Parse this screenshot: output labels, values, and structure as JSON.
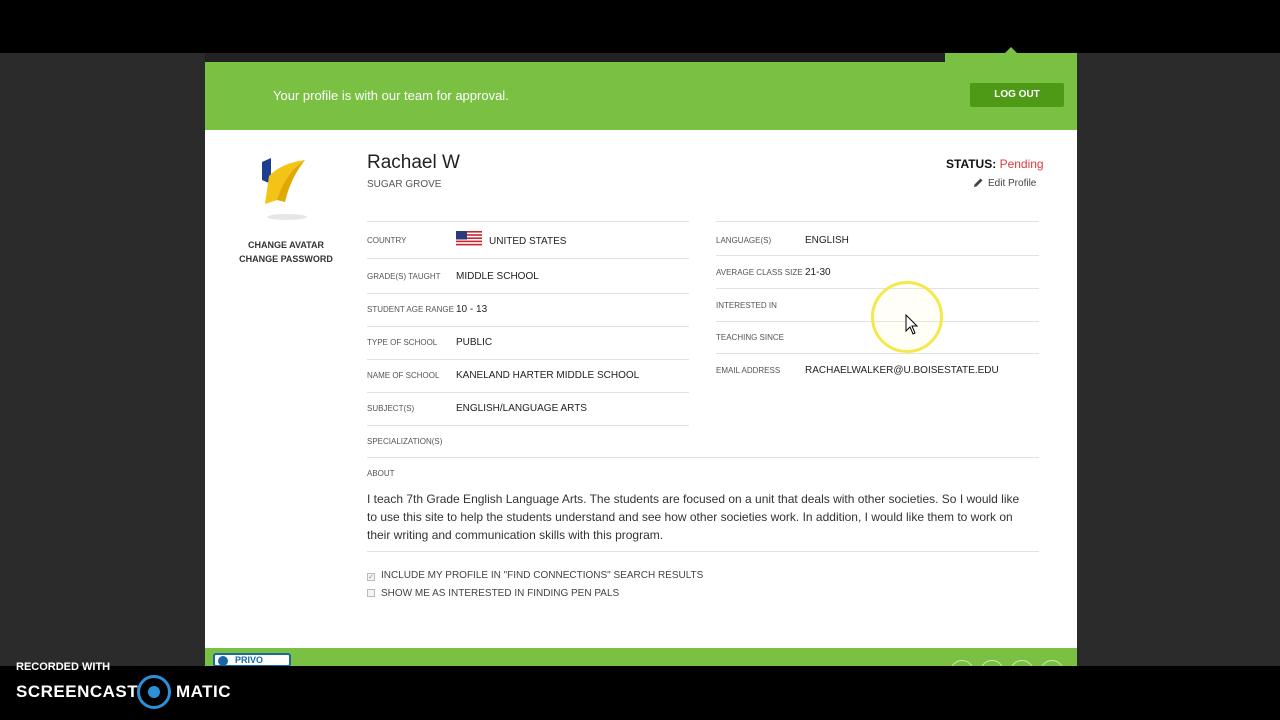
{
  "banner": {
    "message": "Your profile is with our team for approval.",
    "logout_label": "LOG OUT"
  },
  "avatar_links": {
    "change_avatar": "CHANGE AVATAR",
    "change_password": "CHANGE PASSWORD"
  },
  "profile": {
    "name": "Rachael W",
    "city": "SUGAR GROVE",
    "status_label": "STATUS:",
    "status_value": "Pending",
    "edit_label": "Edit Profile"
  },
  "left_fields": [
    {
      "label": "COUNTRY",
      "value": "UNITED STATES"
    },
    {
      "label": "GRADE(S) TAUGHT",
      "value": "MIDDLE SCHOOL"
    },
    {
      "label": "STUDENT AGE RANGE",
      "value": "10 - 13"
    },
    {
      "label": "TYPE OF SCHOOL",
      "value": "PUBLIC"
    },
    {
      "label": "NAME OF SCHOOL",
      "value": "KANELAND HARTER MIDDLE SCHOOL"
    },
    {
      "label": "SUBJECT(S)",
      "value": "ENGLISH/LANGUAGE ARTS"
    },
    {
      "label": "SPECIALIZATION(S)",
      "value": ""
    }
  ],
  "right_fields": [
    {
      "label": "LANGUAGE(S)",
      "value": "ENGLISH"
    },
    {
      "label": "AVERAGE CLASS SIZE",
      "value": "21-30"
    },
    {
      "label": "INTERESTED IN",
      "value": ""
    },
    {
      "label": "TEACHING SINCE",
      "value": ""
    },
    {
      "label": "EMAIL ADDRESS",
      "value": "RACHAELWALKER@U.BOISESTATE.EDU"
    }
  ],
  "about": {
    "label": "ABOUT",
    "text": "I teach 7th Grade English Language Arts. The students are focused on a unit that deals with other societies. So I would like to use this site to help the students understand and see how other societies work. In addition, I would like them to work on their writing and communication skills with this program."
  },
  "options": {
    "include_profile": {
      "label": "INCLUDE MY PROFILE IN \"FIND CONNECTIONS\" SEARCH RESULTS",
      "checked": true
    },
    "pen_pals": {
      "label": "SHOW ME AS INTERESTED IN FINDING PEN PALS",
      "checked": false
    }
  },
  "footer": {
    "privo_label": "PRIVO"
  },
  "recorder": {
    "line1": "RECORDED WITH",
    "brand_left": "SCREENCAST",
    "brand_right": "MATIC"
  },
  "colors": {
    "brand_green": "#7ac143",
    "button_green": "#4e9a16",
    "pending_red": "#e23b3b"
  },
  "icons": [
    "pencil-icon",
    "us-flag-icon",
    "avatar-logo-icon",
    "mouse-cursor-icon",
    "screencast-logo-icon"
  ]
}
